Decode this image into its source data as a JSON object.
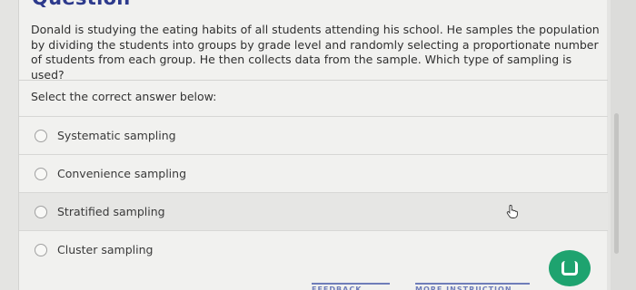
{
  "page": {
    "heading": "Question"
  },
  "question": {
    "text": "Donald is studying the eating habits of all students attending his school. He samples the population by dividing the students into groups by grade level and randomly selecting a proportionate number of students from each group. He then collects data from the sample. Which type of sampling is used?",
    "prompt": "Select the correct answer below:"
  },
  "options": [
    {
      "label": "Systematic sampling",
      "selected": false
    },
    {
      "label": "Convenience sampling",
      "selected": false
    },
    {
      "label": "Stratified sampling",
      "selected": false,
      "hovered": true
    },
    {
      "label": "Cluster sampling",
      "selected": false
    }
  ],
  "footer": {
    "feedback_label": "FEEDBACK",
    "more_instruction_label": "MORE INSTRUCTION"
  },
  "colors": {
    "heading": "#2d3a8c",
    "chat_button": "#1ea36f",
    "footer_link": "#6f7db9"
  },
  "icons": {
    "cursor": "hand-pointer-icon",
    "chat": "chat-icon"
  }
}
